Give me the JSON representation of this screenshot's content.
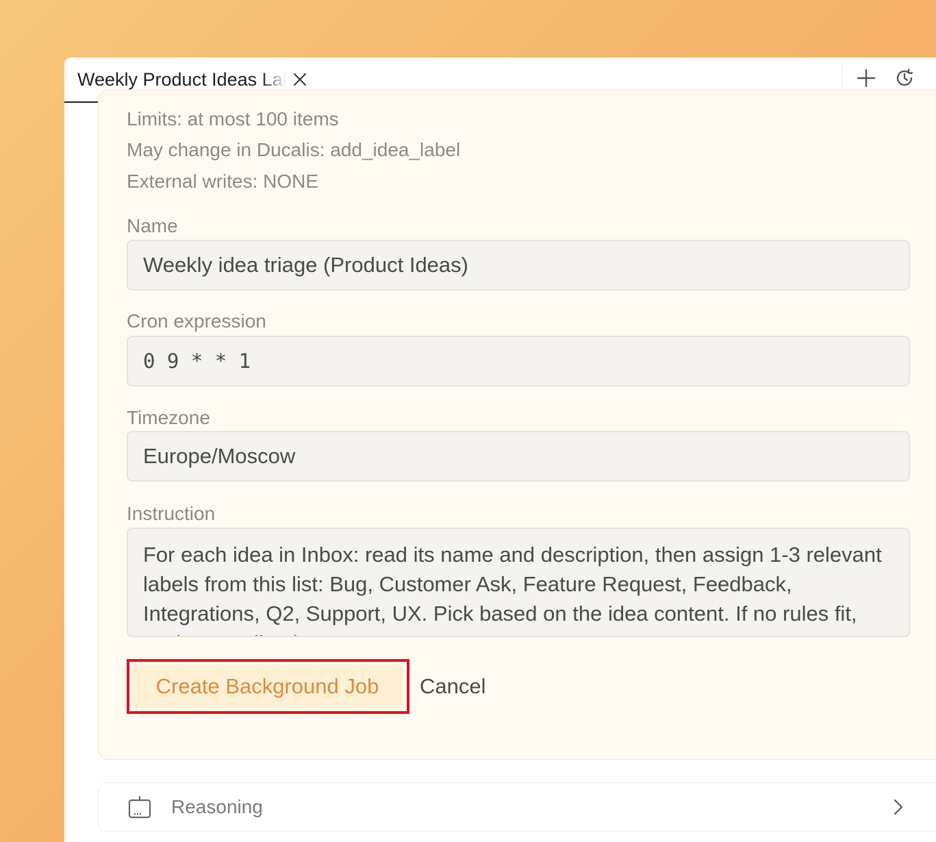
{
  "tab": {
    "title": "Weekly Product Ideas Label Triage",
    "close_icon": "close-icon"
  },
  "tab_actions": {
    "new_tab_icon": "plus-icon",
    "history_icon": "history-icon"
  },
  "job_form": {
    "meta": {
      "limits": "Limits: at most 100 items",
      "may_change": "May change in Ducalis: add_idea_label",
      "external_writes": "External writes: NONE"
    },
    "name": {
      "label": "Name",
      "value": "Weekly idea triage (Product Ideas)"
    },
    "cron": {
      "label": "Cron expression",
      "value": "0 9 * * 1"
    },
    "timezone": {
      "label": "Timezone",
      "value": "Europe/Moscow"
    },
    "instruction": {
      "label": "Instruction",
      "value": "For each idea in Inbox: read its name and description, then assign 1-3 relevant labels from this list: Bug, Customer Ask, Feature Request, Feedback, Integrations, Q2, Support, UX. Pick based on the idea content. If no rules fit, assign Feedback."
    },
    "create_button": "Create Background Job",
    "cancel_button": "Cancel"
  },
  "reasoning": {
    "label": "Reasoning",
    "icon": "robot-icon"
  },
  "colors": {
    "accent_text": "#e08a3e",
    "accent_bg": "#fdf0d4",
    "highlight_border": "#e3121a",
    "card_bg": "#fffbf2"
  }
}
